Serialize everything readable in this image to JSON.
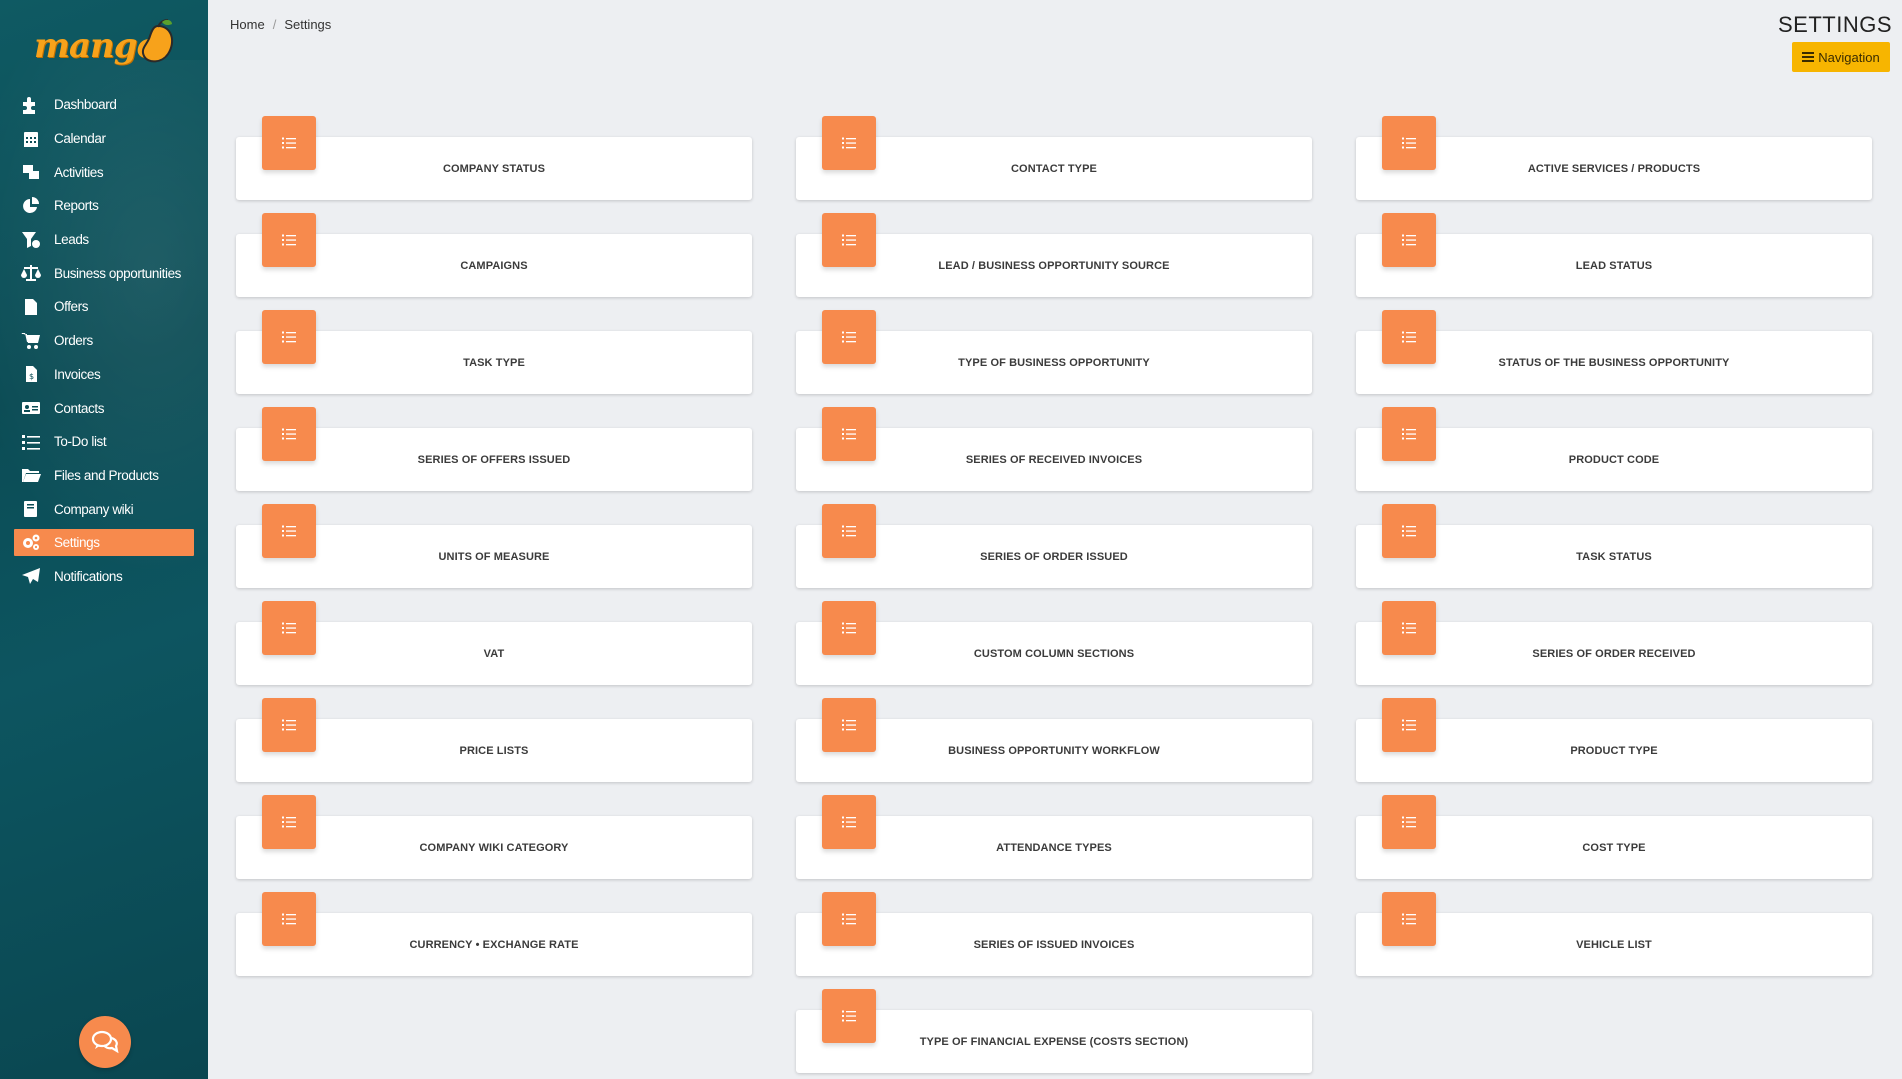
{
  "app": {
    "logo_text": "mango"
  },
  "sidebar": {
    "items": [
      {
        "label": "Dashboard",
        "icon": "puzzle-icon"
      },
      {
        "label": "Calendar",
        "icon": "calendar-icon"
      },
      {
        "label": "Activities",
        "icon": "activities-icon"
      },
      {
        "label": "Reports",
        "icon": "pie-chart-icon"
      },
      {
        "label": "Leads",
        "icon": "funnel-icon"
      },
      {
        "label": "Business opportunities",
        "icon": "scale-icon"
      },
      {
        "label": "Offers",
        "icon": "document-icon"
      },
      {
        "label": "Orders",
        "icon": "cart-icon"
      },
      {
        "label": "Invoices",
        "icon": "invoice-icon"
      },
      {
        "label": "Contacts",
        "icon": "contact-card-icon"
      },
      {
        "label": "To-Do list",
        "icon": "list-icon"
      },
      {
        "label": "Files and Products",
        "icon": "folder-icon"
      },
      {
        "label": "Company wiki",
        "icon": "book-icon"
      },
      {
        "label": "Settings",
        "icon": "gears-icon",
        "active": true
      },
      {
        "label": "Notifications",
        "icon": "paper-plane-icon"
      }
    ]
  },
  "breadcrumb": {
    "home": "Home",
    "separator": "/",
    "current": "Settings"
  },
  "header": {
    "title": "SETTINGS",
    "navigation_button": "Navigation"
  },
  "colors": {
    "accent": "#f78a4d",
    "nav_button": "#f7b500",
    "sidebar": "#0b4c55"
  },
  "settings_cards": {
    "col1": [
      "COMPANY STATUS",
      "CAMPAIGNS",
      "TASK TYPE",
      "SERIES OF OFFERS ISSUED",
      "UNITS OF MEASURE",
      "VAT",
      "PRICE LISTS",
      "COMPANY WIKI CATEGORY",
      "CURRENCY • EXCHANGE RATE"
    ],
    "col2": [
      "CONTACT TYPE",
      "LEAD / BUSINESS OPPORTUNITY SOURCE",
      "TYPE OF BUSINESS OPPORTUNITY",
      "SERIES OF RECEIVED INVOICES",
      "SERIES OF ORDER ISSUED",
      "CUSTOM COLUMN SECTIONS",
      "BUSINESS OPPORTUNITY WORKFLOW",
      "ATTENDANCE TYPES",
      "SERIES OF ISSUED INVOICES",
      "TYPE OF FINANCIAL EXPENSE (COSTS SECTION)"
    ],
    "col3": [
      "ACTIVE SERVICES / PRODUCTS",
      "LEAD STATUS",
      "STATUS OF THE BUSINESS OPPORTUNITY",
      "PRODUCT CODE",
      "TASK STATUS",
      "SERIES OF ORDER RECEIVED",
      "PRODUCT TYPE",
      "COST TYPE",
      "VEHICLE LIST"
    ]
  }
}
